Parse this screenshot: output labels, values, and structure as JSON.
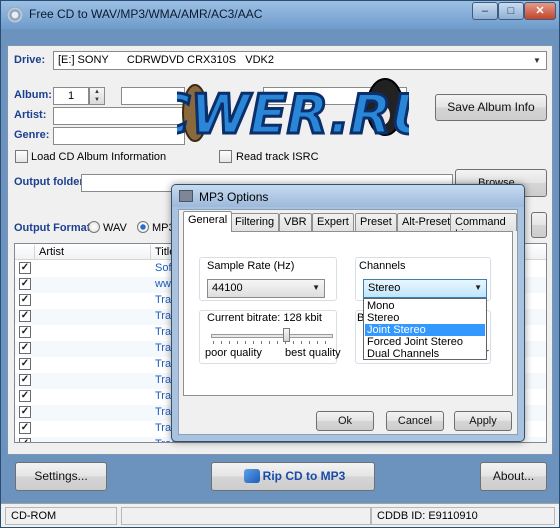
{
  "window": {
    "title": "Free CD to WAV/MP3/WMA/AMR/AC3/AAC",
    "minimize_glyph": "–",
    "maximize_glyph": "□",
    "close_glyph": "✕"
  },
  "drive": {
    "label": "Drive:",
    "value": "[E:] SONY      CDRWDVD CRX310S   VDK2"
  },
  "album": {
    "album_label": "Album:",
    "album_number": "1",
    "artist_label": "Artist:",
    "genre_label": "Genre:",
    "load_info_label": "Load CD Album Information",
    "read_isrc_label": "Read track ISRC",
    "save_button": "Save Album Info"
  },
  "output": {
    "folder_label": "Output folder:",
    "browse_button": "Browse...",
    "format_label": "Output Format:",
    "format_wav": "WAV",
    "format_mp3": "MP3",
    "selected_format": "MP3"
  },
  "tracklist": {
    "headers": {
      "artist": "Artist",
      "title": "Title"
    },
    "rows": [
      {
        "checked": true,
        "title": "Soft"
      },
      {
        "checked": true,
        "title": "www"
      },
      {
        "checked": true,
        "title": "Trac"
      },
      {
        "checked": true,
        "title": "Trac"
      },
      {
        "checked": true,
        "title": "Trac"
      },
      {
        "checked": true,
        "title": "Trac"
      },
      {
        "checked": true,
        "title": "Trac"
      },
      {
        "checked": true,
        "title": "Trac"
      },
      {
        "checked": true,
        "title": "Trac"
      },
      {
        "checked": true,
        "title": "Trac"
      },
      {
        "checked": true,
        "title": "Trac"
      },
      {
        "checked": true,
        "title": "Trac"
      }
    ]
  },
  "bottom": {
    "settings_button": "Settings...",
    "rip_button": "Rip CD to MP3",
    "about_button": "About..."
  },
  "statusbar": {
    "drive": "CD-ROM",
    "cddb": "CDDB ID: E9110910"
  },
  "watermark": {
    "text": "CWER.RU"
  },
  "dialog": {
    "title": "MP3 Options",
    "tabs": [
      "General",
      "Filtering",
      "VBR",
      "Expert",
      "Preset",
      "Alt-Preset",
      "Command Line"
    ],
    "active_tab": "General",
    "sample_rate_label": "Sample Rate (Hz)",
    "sample_rate_value": "44100",
    "channels_label": "Channels",
    "channels_value": "Stereo",
    "channel_options": [
      "Mono",
      "Stereo",
      "Joint Stereo",
      "Forced Joint Stereo",
      "Dual Channels"
    ],
    "highlighted_option": "Joint Stereo",
    "bitrate_label": "Current bitrate:  128 kbit",
    "bitrate_level": 0.62,
    "poor_quality": "poor quality",
    "best_quality": "best quality",
    "other_group_fragment": "B",
    "other_right_fragment": "er",
    "ok_button": "Ok",
    "cancel_button": "Cancel",
    "apply_button": "Apply"
  },
  "colors": {
    "label_blue": "#1c3f8f",
    "title_link_blue": "#1a5fbf",
    "selection": "#3399ff"
  }
}
